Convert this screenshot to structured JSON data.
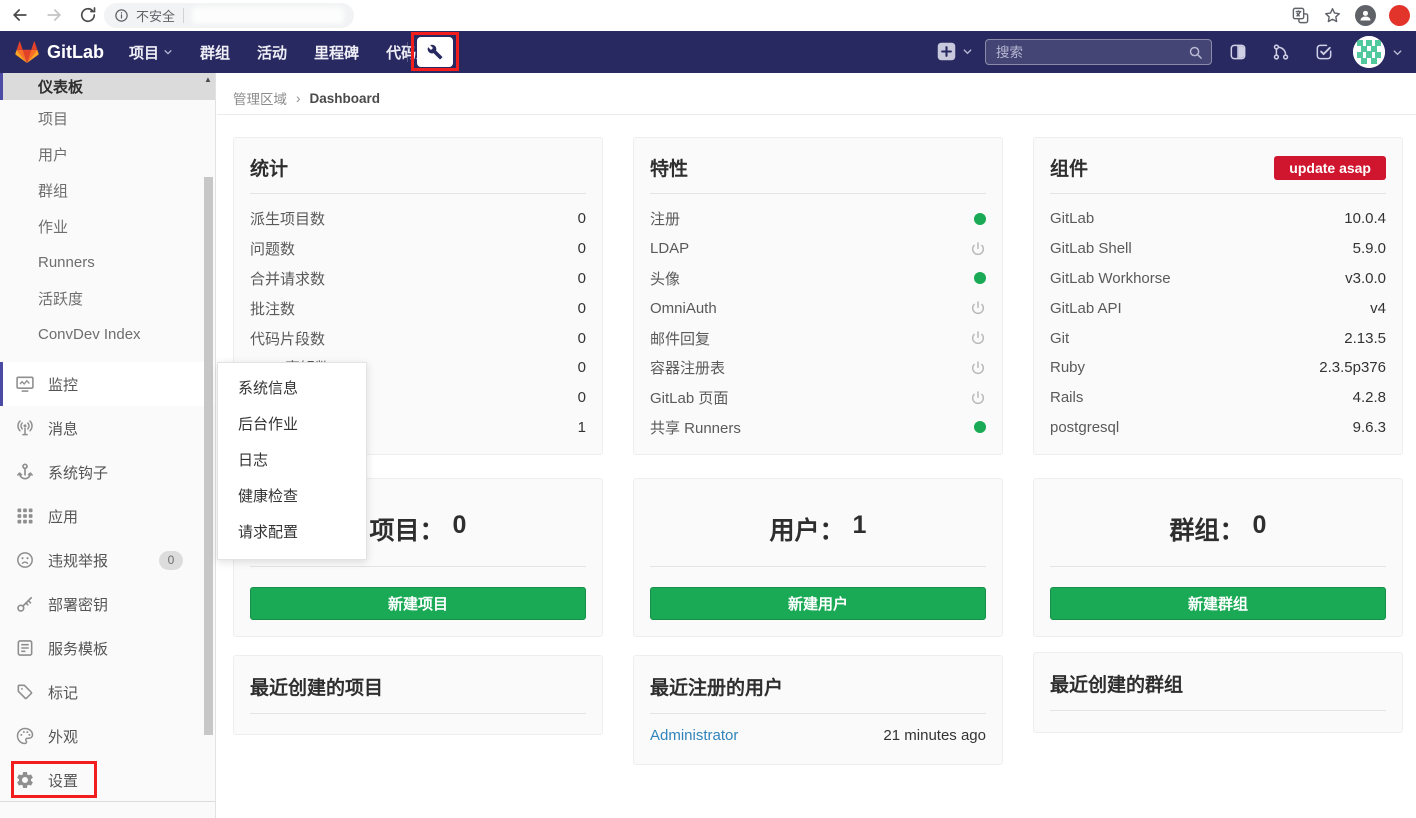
{
  "browser": {
    "security_label": "不安全"
  },
  "navbar": {
    "brand": "GitLab",
    "menu": [
      {
        "label": "项目",
        "has_chevron": true
      },
      {
        "label": "群组"
      },
      {
        "label": "活动"
      },
      {
        "label": "里程碑"
      },
      {
        "label": "代码片段"
      }
    ],
    "search_placeholder": "搜索"
  },
  "sidebar": {
    "overview": [
      {
        "label": "仪表板",
        "active": true
      },
      {
        "label": "项目"
      },
      {
        "label": "用户"
      },
      {
        "label": "群组"
      },
      {
        "label": "作业"
      },
      {
        "label": "Runners"
      },
      {
        "label": "活跃度"
      },
      {
        "label": "ConvDev Index"
      }
    ],
    "sections": [
      {
        "icon": "monitor-icon",
        "label": "监控",
        "open": true
      },
      {
        "icon": "broadcast-icon",
        "label": "消息"
      },
      {
        "icon": "hook-icon",
        "label": "系统钩子"
      },
      {
        "icon": "grid-icon",
        "label": "应用"
      },
      {
        "icon": "frown-icon",
        "label": "违规举报",
        "badge": "0"
      },
      {
        "icon": "key-icon",
        "label": "部署密钥"
      },
      {
        "icon": "template-icon",
        "label": "服务模板"
      },
      {
        "icon": "tag-icon",
        "label": "标记"
      },
      {
        "icon": "palette-icon",
        "label": "外观"
      },
      {
        "icon": "gear-icon",
        "label": "设置",
        "annotated": true
      }
    ],
    "scroll_up_glyph": "▲"
  },
  "flyout": {
    "items": [
      "系统信息",
      "后台作业",
      "日志",
      "健康检查",
      "请求配置"
    ]
  },
  "breadcrumb": {
    "parent": "管理区域",
    "separator": "›",
    "current": "Dashboard"
  },
  "stats": {
    "title": "统计",
    "rows": [
      [
        "派生项目数",
        "0"
      ],
      [
        "问题数",
        "0"
      ],
      [
        "合并请求数",
        "0"
      ],
      [
        "批注数",
        "0"
      ],
      [
        "代码片段数",
        "0"
      ],
      [
        "SSH 密钥数",
        "0"
      ],
      [
        "",
        "0"
      ],
      [
        "",
        "1"
      ]
    ]
  },
  "features": {
    "title": "特性",
    "rows": [
      [
        "注册",
        "on"
      ],
      [
        "LDAP",
        "off"
      ],
      [
        "头像",
        "on"
      ],
      [
        "OmniAuth",
        "off"
      ],
      [
        "邮件回复",
        "off"
      ],
      [
        "容器注册表",
        "off"
      ],
      [
        "GitLab 页面",
        "off"
      ],
      [
        "共享 Runners",
        "on"
      ]
    ]
  },
  "components": {
    "title": "组件",
    "badge": "update asap",
    "rows": [
      [
        "GitLab",
        "10.0.4"
      ],
      [
        "GitLab Shell",
        "5.9.0"
      ],
      [
        "GitLab Workhorse",
        "v3.0.0"
      ],
      [
        "GitLab API",
        "v4"
      ],
      [
        "Git",
        "2.13.5"
      ],
      [
        "Ruby",
        "2.3.5p376"
      ],
      [
        "Rails",
        "4.2.8"
      ],
      [
        "postgresql",
        "9.6.3"
      ]
    ]
  },
  "counts": {
    "projects": {
      "title": "项目：",
      "count": "0",
      "button": "新建项目"
    },
    "users": {
      "title": "用户：",
      "count": "1",
      "button": "新建用户"
    },
    "groups": {
      "title": "群组：",
      "count": "0",
      "button": "新建群组"
    }
  },
  "recent": {
    "projects": {
      "title": "最近创建的项目"
    },
    "users": {
      "title": "最近注册的用户",
      "rows": [
        {
          "name": "Administrator",
          "time": "21 minutes ago"
        }
      ]
    },
    "groups": {
      "title": "最近创建的群组"
    }
  },
  "colors": {
    "navbar_bg": "#292961",
    "accent_green": "#1aaa55",
    "badge_red": "#d0162e",
    "link_blue": "#3084bb",
    "annotation_red": "#f21d1d",
    "active_indicator": "#4b4ba6"
  }
}
